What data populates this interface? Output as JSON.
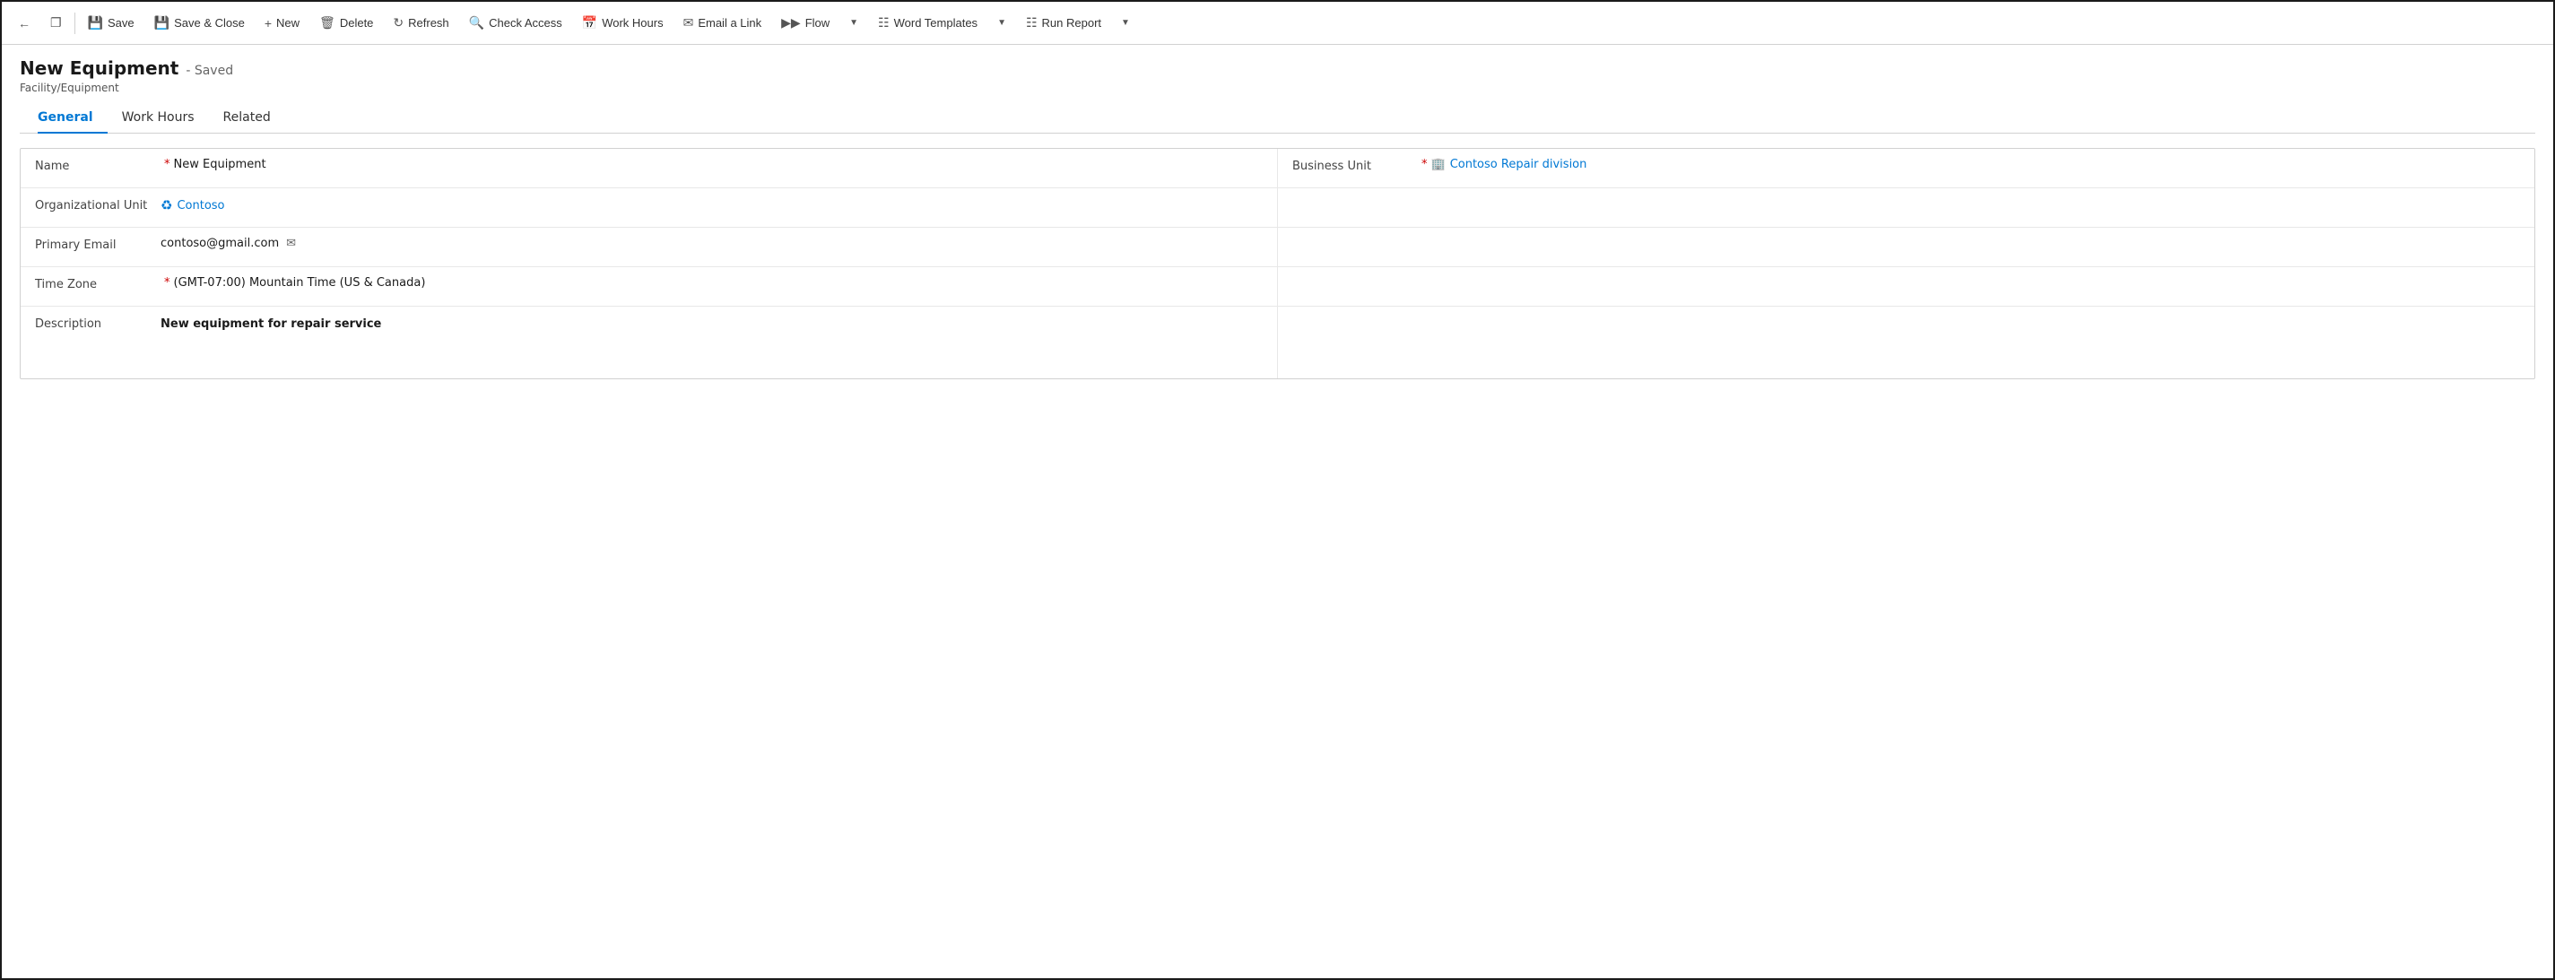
{
  "toolbar": {
    "back_label": "←",
    "window_label": "⧉",
    "save_label": "Save",
    "save_close_label": "Save & Close",
    "new_label": "New",
    "delete_label": "Delete",
    "refresh_label": "Refresh",
    "check_access_label": "Check Access",
    "work_hours_label": "Work Hours",
    "email_link_label": "Email a Link",
    "flow_label": "Flow",
    "word_templates_label": "Word Templates",
    "run_report_label": "Run Report"
  },
  "page": {
    "title": "New Equipment",
    "saved_status": "- Saved",
    "subtitle": "Facility/Equipment"
  },
  "tabs": [
    {
      "id": "general",
      "label": "General",
      "active": true
    },
    {
      "id": "work_hours",
      "label": "Work Hours",
      "active": false
    },
    {
      "id": "related",
      "label": "Related",
      "active": false
    }
  ],
  "form": {
    "name_label": "Name",
    "name_value": "New Equipment",
    "business_unit_label": "Business Unit",
    "business_unit_value": "Contoso Repair division",
    "org_unit_label": "Organizational Unit",
    "org_unit_value": "Contoso",
    "primary_email_label": "Primary Email",
    "primary_email_value": "contoso@gmail.com",
    "time_zone_label": "Time Zone",
    "time_zone_value": "(GMT-07:00) Mountain Time (US & Canada)",
    "description_label": "Description",
    "description_value": "New equipment for repair service"
  }
}
